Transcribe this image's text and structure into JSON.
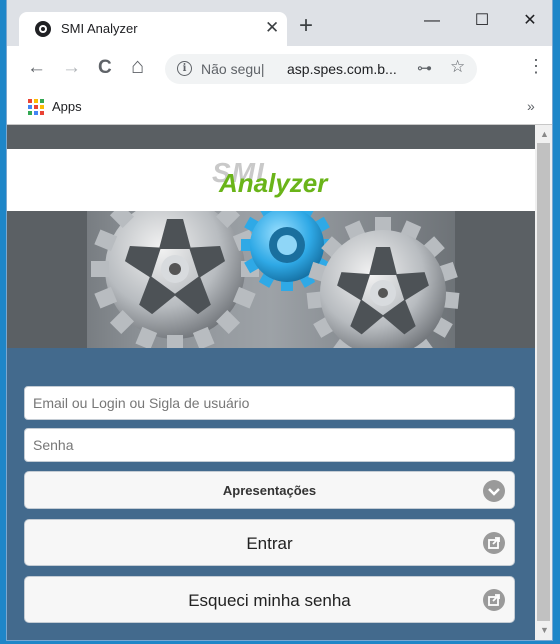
{
  "browser": {
    "tab_title": "SMI Analyzer",
    "tab_close": "✕",
    "new_tab": "+",
    "minimize": "—",
    "maximize": "☐",
    "close": "✕",
    "back": "←",
    "forward": "→",
    "reload": "C",
    "home": "⌂",
    "security_text": "Não segu|",
    "url": "asp.spes.com.b...",
    "key": "⊶",
    "star": "☆",
    "menu": "⋮",
    "bookmarks_apps": "Apps",
    "bookmarks_more": "»"
  },
  "page": {
    "logo_smi": "SMI",
    "logo_analyzer": "Analyzer",
    "login_placeholder": "Email ou Login ou Sigla de usuário",
    "password_placeholder": "Senha",
    "select_label": "Apresentações",
    "enter_button": "Entrar",
    "forgot_button": "Esqueci minha senha"
  },
  "colors": {
    "brand_green": "#6ab419",
    "form_background": "#436a8d",
    "gear_blue": "#2fa9e6"
  }
}
